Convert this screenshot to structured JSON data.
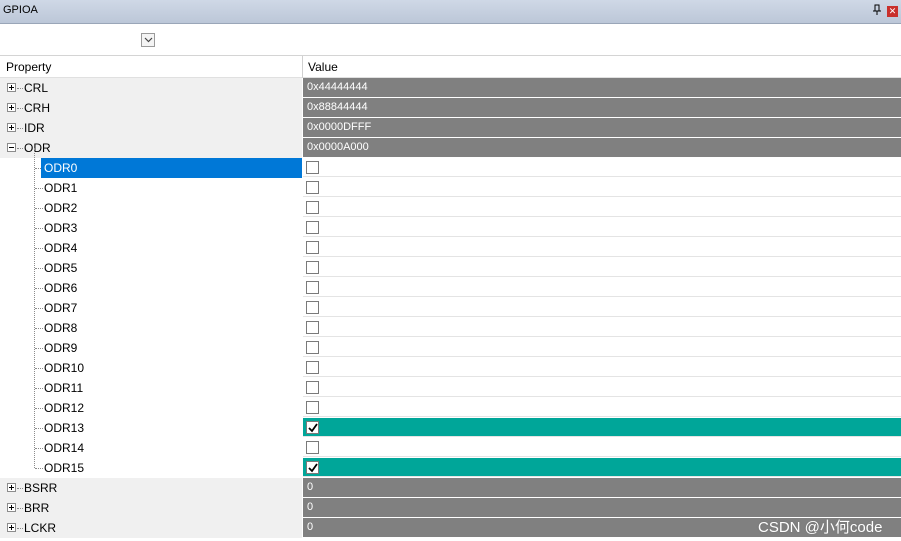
{
  "window": {
    "title": "GPIOA",
    "pin_icon": "pin-icon",
    "close_icon": "close-icon"
  },
  "toolbar": {
    "combo_value": "",
    "dropdown_icon": "chevron-down-icon"
  },
  "columns": {
    "property": "Property",
    "value": "Value"
  },
  "registers_top": [
    {
      "name": "CRL",
      "value": "0x44444444",
      "expanded": false
    },
    {
      "name": "CRH",
      "value": "0x88844444",
      "expanded": false
    },
    {
      "name": "IDR",
      "value": "0x0000DFFF",
      "expanded": false
    },
    {
      "name": "ODR",
      "value": "0x0000A000",
      "expanded": true
    }
  ],
  "odr_bits": [
    {
      "name": "ODR0",
      "checked": false,
      "selected": true
    },
    {
      "name": "ODR1",
      "checked": false
    },
    {
      "name": "ODR2",
      "checked": false
    },
    {
      "name": "ODR3",
      "checked": false
    },
    {
      "name": "ODR4",
      "checked": false
    },
    {
      "name": "ODR5",
      "checked": false
    },
    {
      "name": "ODR6",
      "checked": false
    },
    {
      "name": "ODR7",
      "checked": false
    },
    {
      "name": "ODR8",
      "checked": false
    },
    {
      "name": "ODR9",
      "checked": false
    },
    {
      "name": "ODR10",
      "checked": false
    },
    {
      "name": "ODR11",
      "checked": false
    },
    {
      "name": "ODR12",
      "checked": false
    },
    {
      "name": "ODR13",
      "checked": true
    },
    {
      "name": "ODR14",
      "checked": false
    },
    {
      "name": "ODR15",
      "checked": true
    }
  ],
  "registers_bottom": [
    {
      "name": "BSRR",
      "value": "0",
      "expanded": false
    },
    {
      "name": "BRR",
      "value": "0",
      "expanded": false
    },
    {
      "name": "LCKR",
      "value": "0",
      "expanded": false
    }
  ],
  "colors": {
    "selected": "#0078d7",
    "checked_row": "#00a699",
    "register_value_bg": "#808080"
  },
  "watermark": "CSDN @小何code"
}
